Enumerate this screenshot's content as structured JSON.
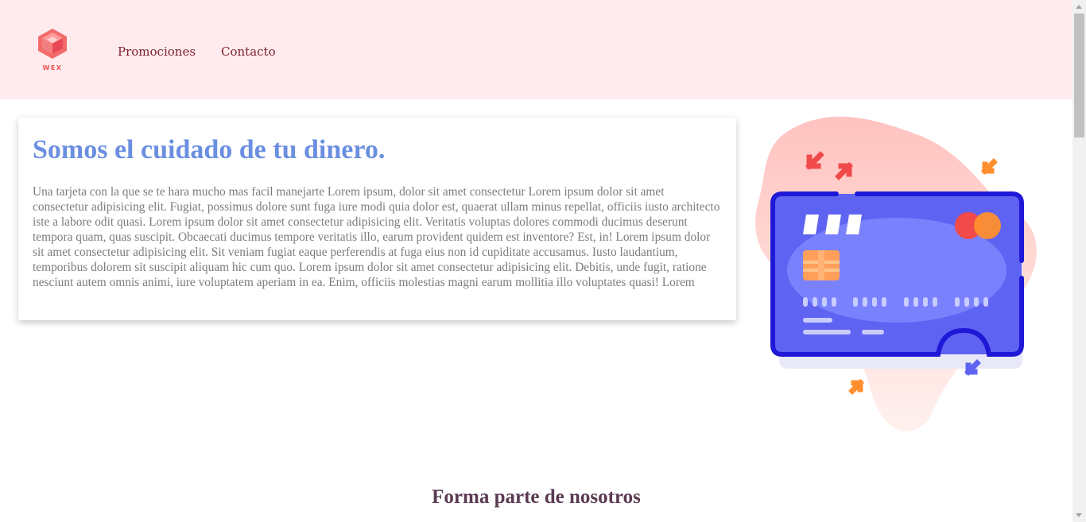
{
  "brand": {
    "logo_text": "WEX",
    "color": "#ef5350"
  },
  "nav": {
    "items": [
      {
        "label": "Promociones"
      },
      {
        "label": "Contacto"
      }
    ]
  },
  "hero": {
    "title": "Somos el cuidado de tu dinero.",
    "body": "Una tarjeta con la que se te hara mucho mas facil manejarte Lorem ipsum, dolor sit amet consectetur Lorem ipsum dolor sit amet consectetur adipisicing elit. Fugiat, possimus dolore sunt fuga iure modi quia dolor est, quaerat ullam minus repellat, officiis iusto architecto iste a labore odit quasi. Lorem ipsum dolor sit amet consectetur adipisicing elit. Veritatis voluptas dolores commodi ducimus deserunt tempora quam, quas suscipit. Obcaecati ducimus tempore veritatis illo, earum provident quidem est inventore? Est, in! Lorem ipsum dolor sit amet consectetur adipisicing elit. Sit veniam fugiat eaque perferendis at fuga eius non id cupiditate accusamus. Iusto laudantium, temporibus dolorem sit suscipit aliquam hic cum quo. Lorem ipsum dolor sit amet consectetur adipisicing elit. Debitis, unde fugit, ratione nesciunt autem omnis animi, iure voluptatem aperiam in ea. Enim, officiis molestias magni earum mollitia illo voluptates quasi! Lorem"
  },
  "illustration": {
    "icon": "credit-card-illustration"
  },
  "section": {
    "title": "Forma parte de nosotros"
  },
  "colors": {
    "header_bg": "#ffebee",
    "title_blue": "#6b8fe0",
    "card_fill": "#5f63f2",
    "card_border": "#1f18d6",
    "accent_orange": "#ff8f2e",
    "accent_red": "#f14a4a"
  }
}
